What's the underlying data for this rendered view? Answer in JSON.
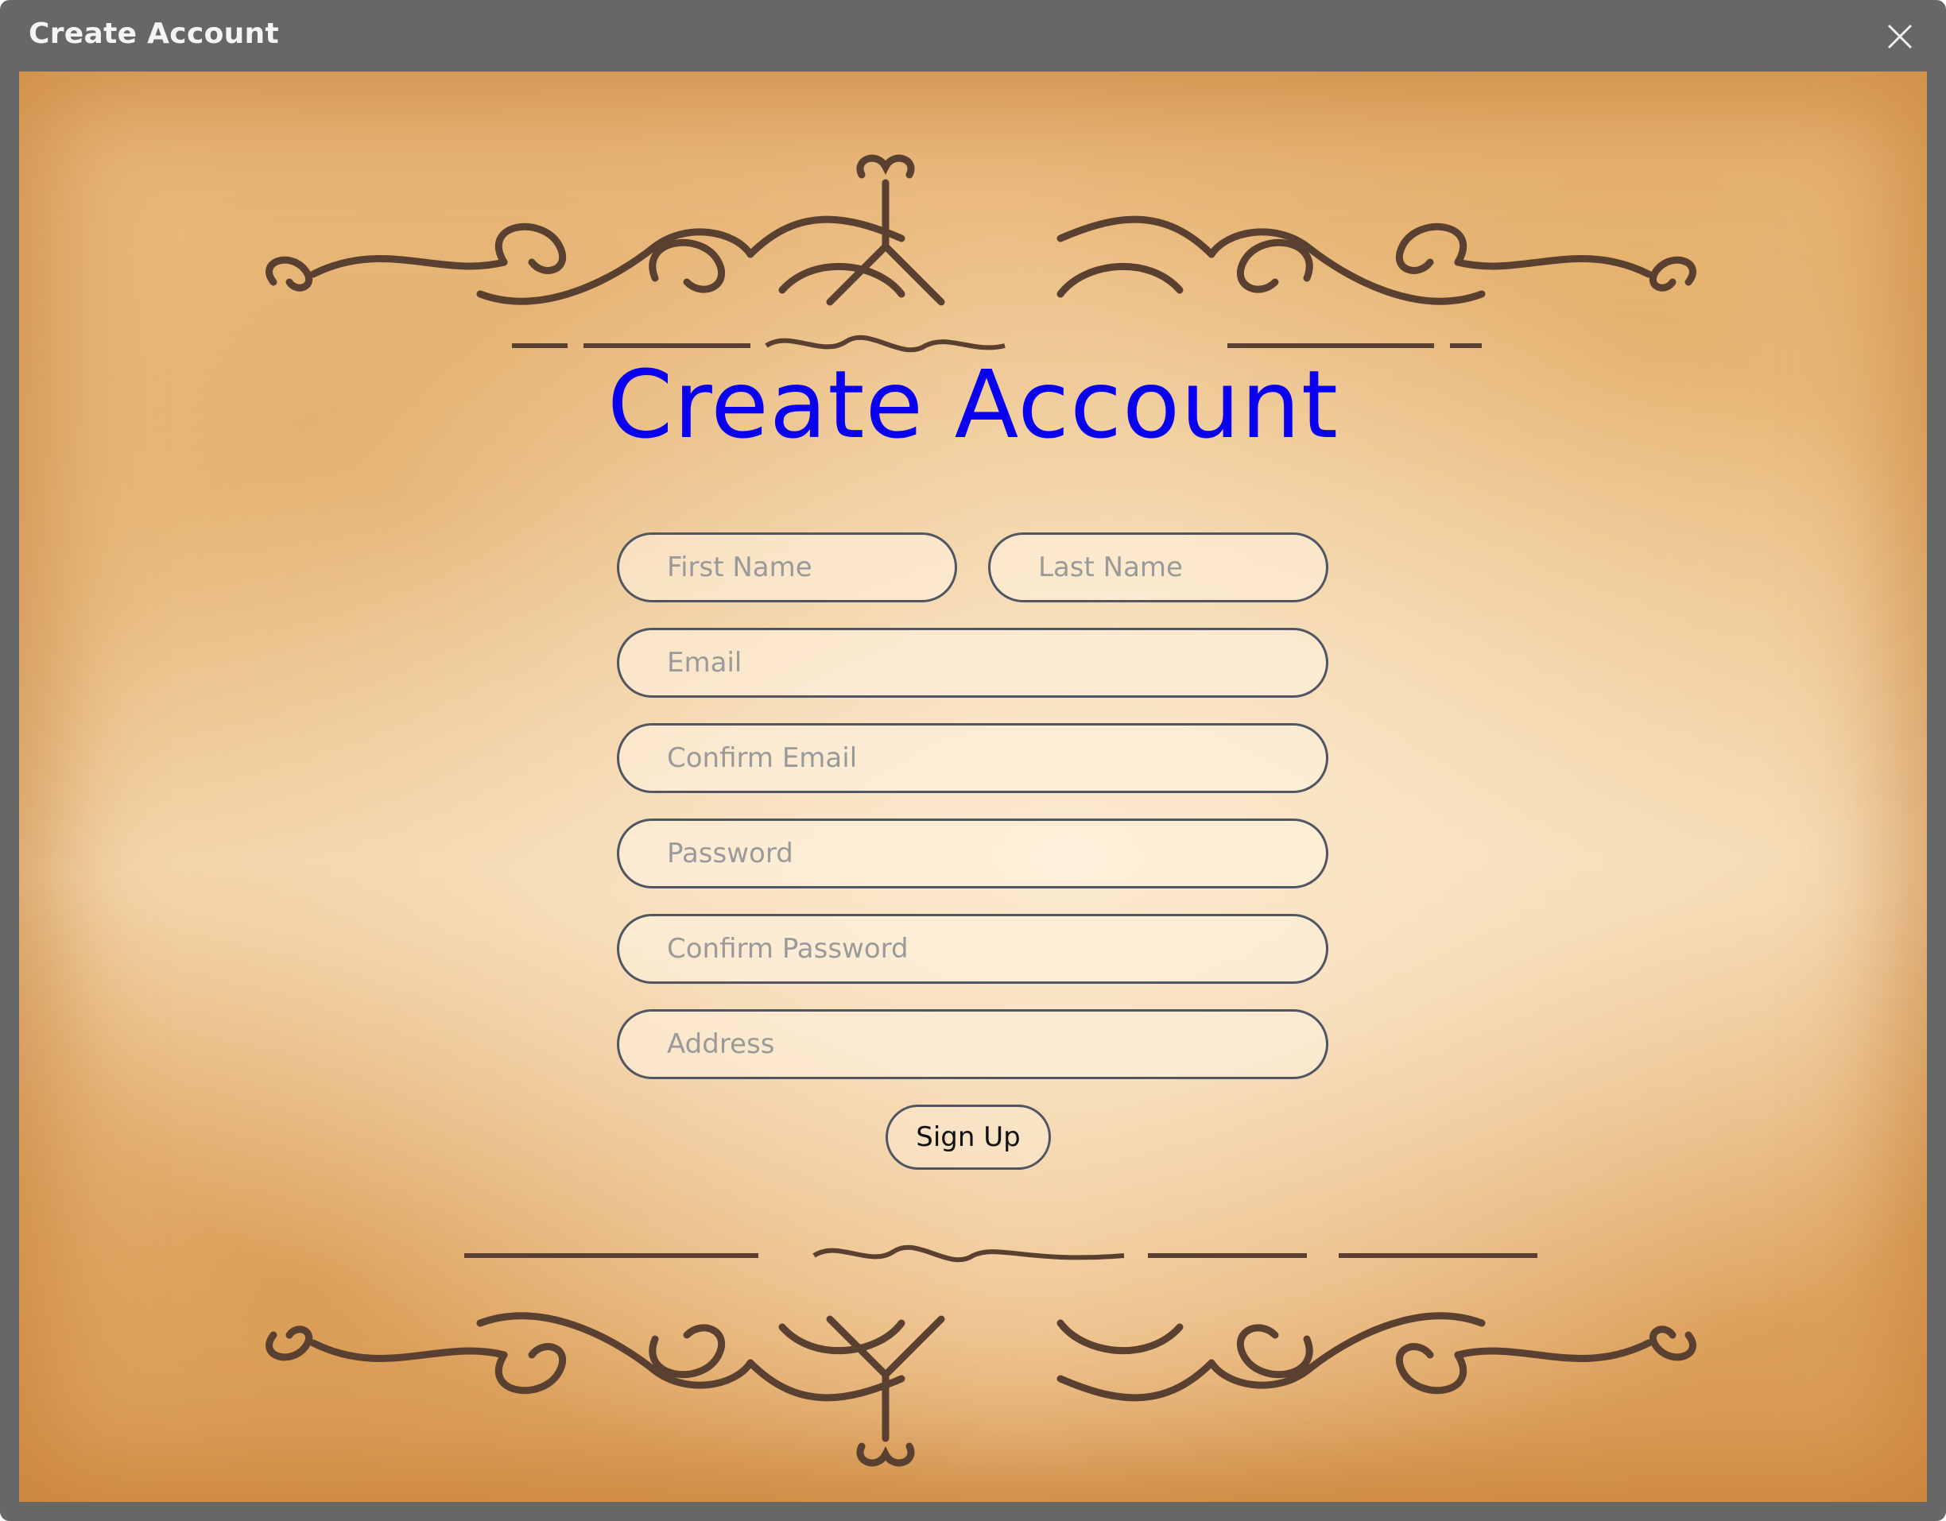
{
  "window": {
    "title": "Create Account"
  },
  "form": {
    "heading": "Create Account",
    "fields": {
      "first_name": {
        "placeholder": "First Name",
        "value": ""
      },
      "last_name": {
        "placeholder": "Last Name",
        "value": ""
      },
      "email": {
        "placeholder": "Email",
        "value": ""
      },
      "confirm_email": {
        "placeholder": "Confirm Email",
        "value": ""
      },
      "password": {
        "placeholder": "Password",
        "value": ""
      },
      "confirm_password": {
        "placeholder": "Confirm Password",
        "value": ""
      },
      "address": {
        "placeholder": "Address",
        "value": ""
      }
    },
    "submit_label": "Sign Up"
  },
  "icons": {
    "close": "close-icon",
    "ornament": "flourish-ornament-icon"
  },
  "colors": {
    "titlebar": "#676767",
    "heading": "#0a00f0",
    "field_border": "#4f5561",
    "parchment": "#f1cc98"
  }
}
